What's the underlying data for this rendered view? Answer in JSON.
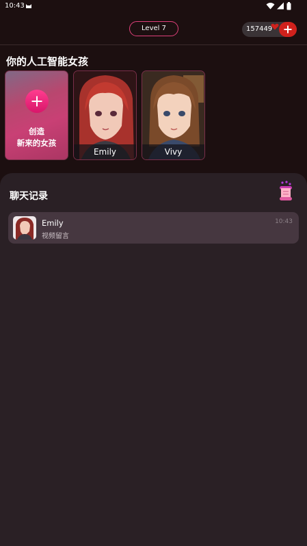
{
  "status_bar": {
    "time": "10:43"
  },
  "header": {
    "level": "Level 7",
    "coins": "157449"
  },
  "section": {
    "title": "你的人工智能女孩"
  },
  "cards": [
    {
      "type": "create",
      "label": "创造\n新来的女孩"
    },
    {
      "type": "character",
      "name": "Emily"
    },
    {
      "type": "character",
      "name": "Vivy"
    }
  ],
  "chat": {
    "title": "聊天记录",
    "items": [
      {
        "name": "Emily",
        "preview": "视频留言",
        "time": "10:43"
      }
    ]
  },
  "colors": {
    "background": "#1c0f10",
    "panel": "#2a2025",
    "chat_row": "#463740",
    "accent_pink": "#e0407a",
    "add_red": "#d0211c"
  },
  "icons": [
    "cat-app-icon",
    "wifi-icon",
    "signal-icon",
    "battery-icon",
    "heart-coin-icon",
    "plus-icon",
    "scroll-icon"
  ]
}
